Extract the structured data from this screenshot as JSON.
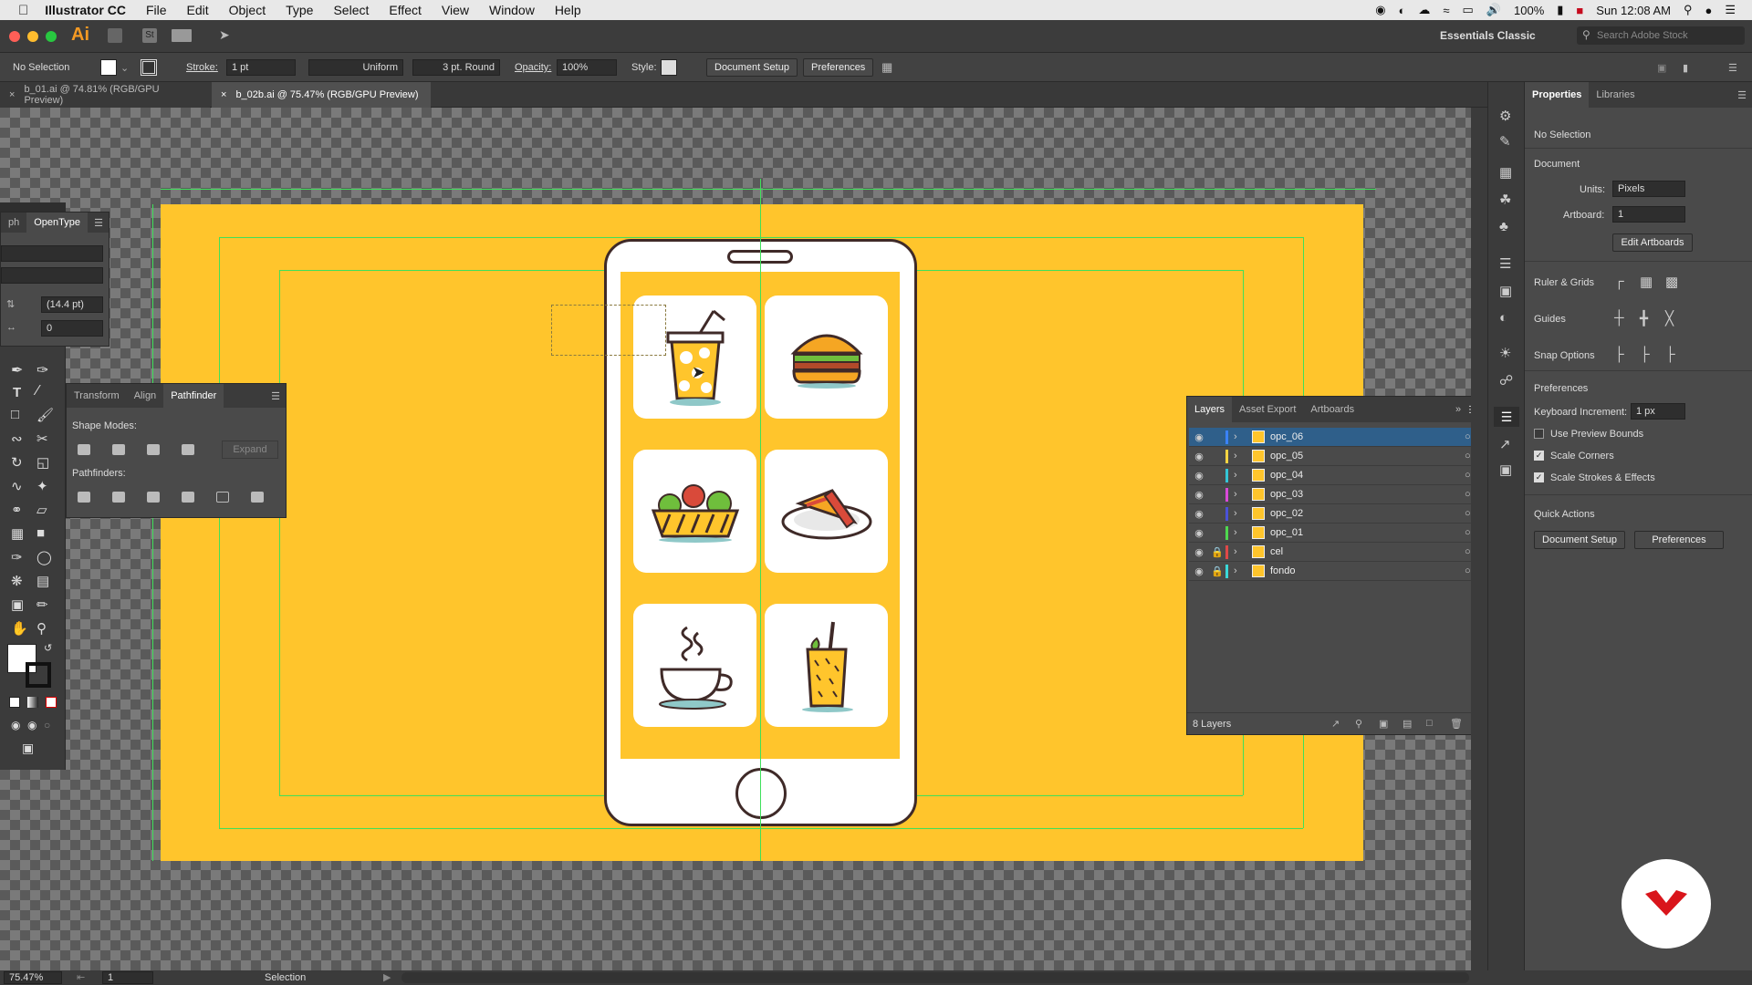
{
  "menubar": {
    "app_name": "Illustrator CC",
    "items": [
      "File",
      "Edit",
      "Object",
      "Type",
      "Select",
      "Effect",
      "View",
      "Window",
      "Help"
    ],
    "battery": "100%",
    "clock": "Sun 12:08 AM"
  },
  "titlebar": {
    "app_icon": "Ai",
    "workspace": "Essentials Classic",
    "search_placeholder": "Search Adobe Stock"
  },
  "control_bar": {
    "selection": "No Selection",
    "stroke_label": "Stroke:",
    "stroke_value": "1 pt",
    "profile": "Uniform",
    "brush": "3 pt. Round",
    "opacity_label": "Opacity:",
    "opacity_value": "100%",
    "style_label": "Style:",
    "doc_setup": "Document Setup",
    "preferences": "Preferences"
  },
  "tabs": [
    {
      "label": "b_01.ai @ 74.81% (RGB/GPU Preview)"
    },
    {
      "label": "b_02b.ai @ 75.47% (RGB/GPU Preview)"
    }
  ],
  "char_panel": {
    "tab1": "ph",
    "tab2": "OpenType",
    "leading": "(14.4 pt)",
    "tracking": "0"
  },
  "pathfinder_panel": {
    "tabs": [
      "Transform",
      "Align",
      "Pathfinder"
    ],
    "shape_modes": "Shape Modes:",
    "expand": "Expand",
    "pathfinders": "Pathfinders:"
  },
  "layers_panel": {
    "tabs": [
      "Layers",
      "Asset Export",
      "Artboards"
    ],
    "layers": [
      {
        "name": "opc_06",
        "color": "#3a82f7",
        "locked": false,
        "selected": true
      },
      {
        "name": "opc_05",
        "color": "#f5d442",
        "locked": false,
        "selected": false
      },
      {
        "name": "opc_04",
        "color": "#33c6d6",
        "locked": false,
        "selected": false
      },
      {
        "name": "opc_03",
        "color": "#d94ad8",
        "locked": false,
        "selected": false
      },
      {
        "name": "opc_02",
        "color": "#4a52d8",
        "locked": false,
        "selected": false
      },
      {
        "name": "opc_01",
        "color": "#4fd84f",
        "locked": false,
        "selected": false
      },
      {
        "name": "cel",
        "color": "#e04848",
        "locked": true,
        "selected": false
      },
      {
        "name": "fondo",
        "color": "#3ad8d8",
        "locked": true,
        "selected": false
      }
    ],
    "count": "8 Layers"
  },
  "properties_panel": {
    "tabs": [
      "Properties",
      "Libraries"
    ],
    "no_selection": "No Selection",
    "document": "Document",
    "units_label": "Units:",
    "units_value": "Pixels",
    "artboard_label": "Artboard:",
    "artboard_value": "1",
    "edit_artboards": "Edit Artboards",
    "ruler_grids": "Ruler & Grids",
    "guides": "Guides",
    "snap_options": "Snap Options",
    "preferences": "Preferences",
    "keyboard_increment_label": "Keyboard Increment:",
    "keyboard_increment_value": "1 px",
    "use_preview_bounds": "Use Preview Bounds",
    "scale_corners": "Scale Corners",
    "scale_strokes": "Scale Strokes & Effects",
    "quick_actions": "Quick Actions",
    "qa_doc_setup": "Document Setup",
    "qa_preferences": "Preferences"
  },
  "status_bar": {
    "zoom": "75.47%",
    "artboard": "1",
    "tool": "Selection"
  },
  "colors": {
    "artboard": "#ffc52c",
    "guide": "#3fe05a",
    "phone_outline": "#3f2a28",
    "logo_red": "#d9151b"
  }
}
